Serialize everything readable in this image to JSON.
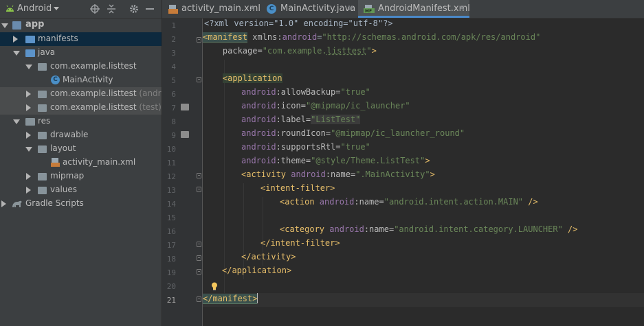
{
  "project_panel": {
    "view_mode": "Android",
    "tree": [
      {
        "label": "app",
        "bold": true,
        "state": "expanded"
      },
      {
        "label": "manifests",
        "state": "collapsed",
        "selected": true
      },
      {
        "label": "java",
        "state": "expanded"
      },
      {
        "label": "com.example.listtest",
        "state": "expanded"
      },
      {
        "label": "MainActivity",
        "state": "leaf"
      },
      {
        "label": "com.example.listtest",
        "suffix": "(androidT",
        "state": "collapsed"
      },
      {
        "label": "com.example.listtest",
        "suffix": "(test)",
        "state": "collapsed"
      },
      {
        "label": "res",
        "state": "expanded"
      },
      {
        "label": "drawable",
        "state": "collapsed"
      },
      {
        "label": "layout",
        "state": "expanded"
      },
      {
        "label": "activity_main.xml",
        "state": "leaf"
      },
      {
        "label": "mipmap",
        "state": "collapsed"
      },
      {
        "label": "values",
        "state": "collapsed"
      },
      {
        "label": "Gradle Scripts",
        "state": "collapsed"
      }
    ]
  },
  "tabs": [
    {
      "label": "activity_main.xml",
      "icon": "layout-xml-icon",
      "active": false
    },
    {
      "label": "MainActivity.java",
      "icon": "java-class-icon",
      "active": false
    },
    {
      "label": "AndroidManifest.xml",
      "icon": "manifest-icon",
      "active": true
    }
  ],
  "editor": {
    "current_line": 21,
    "line_numbers": [
      "1",
      "2",
      "3",
      "4",
      "5",
      "6",
      "7",
      "8",
      "9",
      "10",
      "11",
      "12",
      "13",
      "14",
      "15",
      "16",
      "17",
      "18",
      "19",
      "20",
      "21"
    ],
    "lines": {
      "l1": "<?xml version=\"1.0\" encoding=\"utf-8\"?>",
      "l2a": "<manifest",
      "l2b": " xmlns:",
      "l2c": "android",
      "l2d": "=",
      "l2e": "\"http://schemas.android.com/apk/res/android\"",
      "l3a": "    package=",
      "l3b": "\"com.example.",
      "l3c": "listtest",
      "l3d": "\"",
      "l3e": ">",
      "l5a": "    ",
      "l5b": "<application",
      "l6a": "android",
      "l6b": ":allowBackup=",
      "l6c": "\"true\"",
      "l7a": "android",
      "l7b": ":icon=",
      "l7c": "\"@mipmap/ic_launcher\"",
      "l8a": "android",
      "l8b": ":label=",
      "l8c": "\"ListTest\"",
      "l9a": "android",
      "l9b": ":roundIcon=",
      "l9c": "\"@mipmap/ic_launcher_round\"",
      "l10a": "android",
      "l10b": ":supportsRtl=",
      "l10c": "\"true\"",
      "l11a": "android",
      "l11b": ":theme=",
      "l11c": "\"@style/Theme.ListTest\"",
      "l11d": ">",
      "l12a": "<activity ",
      "l12b": "android",
      "l12c": ":name=",
      "l12d": "\".MainActivity\"",
      "l12e": ">",
      "l13": "<intent-filter>",
      "l14a": "<action ",
      "l14b": "android",
      "l14c": ":name=",
      "l14d": "\"android.intent.action.MAIN\"",
      "l14e": " />",
      "l16a": "<category ",
      "l16b": "android",
      "l16c": ":name=",
      "l16d": "\"android.intent.category.LAUNCHER\"",
      "l16e": " />",
      "l17": "</intent-filter>",
      "l18": "</activity>",
      "l19": "</application>",
      "l21": "</manifest>"
    }
  },
  "colors": {
    "tag": "#e8bf6a",
    "namespace": "#9876aa",
    "string": "#6a8759",
    "text": "#a9b7c6",
    "accent": "#4a88c7"
  }
}
